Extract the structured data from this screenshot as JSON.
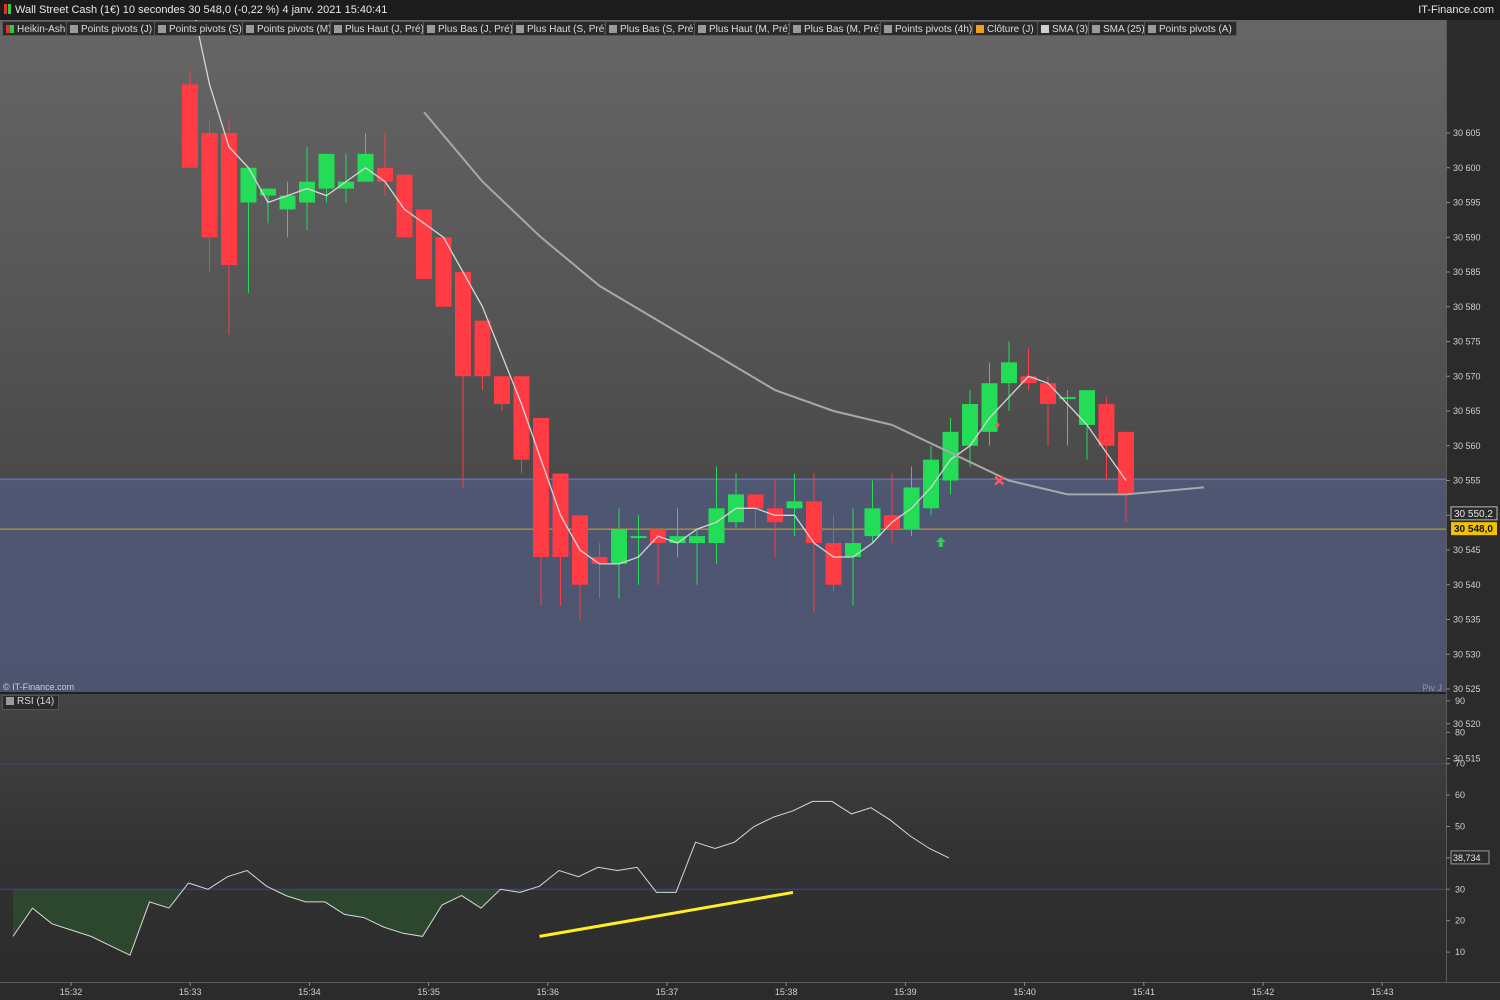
{
  "header": {
    "title": "Wall Street Cash (1€) 10 secondes 30 548,0 (-0,22 %) 4 janv. 2021 15:40:41",
    "brand": "IT-Finance.com"
  },
  "legend": [
    {
      "label": "Heikin-Ashi",
      "swatch": "ha"
    },
    {
      "label": "Points pivots (J)",
      "swatch": "#9a9a9a"
    },
    {
      "label": "Points pivots (S)",
      "swatch": "#9a9a9a"
    },
    {
      "label": "Points pivots (M)",
      "swatch": "#9a9a9a"
    },
    {
      "label": "Plus Haut (J, Pré)",
      "swatch": "#9a9a9a"
    },
    {
      "label": "Plus Bas (J, Pré)",
      "swatch": "#9a9a9a"
    },
    {
      "label": "Plus Haut (S, Pré)",
      "swatch": "#9a9a9a"
    },
    {
      "label": "Plus Bas (S, Pré)",
      "swatch": "#9a9a9a"
    },
    {
      "label": "Plus Haut (M, Pré)",
      "swatch": "#9a9a9a"
    },
    {
      "label": "Plus Bas (M, Pré)",
      "swatch": "#9a9a9a"
    },
    {
      "label": "Points pivots (4h)",
      "swatch": "#9a9a9a"
    },
    {
      "label": "Clôture (J)",
      "swatch": "#f0a020"
    },
    {
      "label": "SMA (3)",
      "swatch": "#cfcfcf"
    },
    {
      "label": "SMA (25)",
      "swatch": "#9a9a9a"
    },
    {
      "label": "Points pivots (A)",
      "swatch": "#9a9a9a"
    }
  ],
  "copyright": "© IT-Finance.com",
  "rsi_label": "RSI (14)",
  "pivot_label": "Piv J",
  "price_badges": {
    "sma": "30 550,2",
    "close": "30 548,0",
    "rsi": "38,734"
  },
  "colors": {
    "bull": "#22dd55",
    "bear": "#ff3b44",
    "pivot_band": "#50597a",
    "pivot_line": "#6b7fe8",
    "close_line": "#e0a020",
    "rsi_trend": "#ffee22",
    "rsi_fill": "#2d4a30",
    "ha_icon_green": "#2ecc40",
    "ha_icon_red": "#e83030"
  },
  "chart_data": [
    {
      "type": "candlestick",
      "title": "Wall Street Cash (1€) 10 secondes",
      "ylim": [
        30510,
        30610
      ],
      "y_ticks": [
        "30 515",
        "30 520",
        "30 525",
        "30 530",
        "30 535",
        "30 540",
        "30 545",
        "30 550",
        "30 555",
        "30 560",
        "30 565",
        "30 570",
        "30 575",
        "30 580",
        "30 585",
        "30 590",
        "30 595",
        "30 600",
        "30 605"
      ],
      "x_ticks": [
        "15:32",
        "15:33",
        "15:34",
        "15:35",
        "15:36",
        "15:37",
        "15:38",
        "15:39",
        "15:40",
        "15:41",
        "15:42",
        "15:43"
      ],
      "levels": {
        "pivot_band_top": 30555.2,
        "pivot_band_bottom": 30524.0,
        "close_j": 30548.0
      },
      "candles": [
        [
          30612,
          30600,
          30614,
          30600
        ],
        [
          30605,
          30590,
          30607,
          30585
        ],
        [
          30605,
          30586,
          30607,
          30576
        ],
        [
          30595,
          30600,
          30599,
          30582
        ],
        [
          30596,
          30597,
          30597,
          30592
        ],
        [
          30594,
          30596,
          30598,
          30590
        ],
        [
          30595,
          30598,
          30603,
          30591
        ],
        [
          30597,
          30602,
          30602,
          30595
        ],
        [
          30597,
          30598,
          30602,
          30595
        ],
        [
          30598,
          30602,
          30605,
          30598
        ],
        [
          30600,
          30598,
          30605,
          30596
        ],
        [
          30599,
          30590,
          30599,
          30590
        ],
        [
          30594,
          30584,
          30594,
          30584
        ],
        [
          30590,
          30580,
          30590,
          30580
        ],
        [
          30585,
          30570,
          30585,
          30554
        ],
        [
          30578,
          30570,
          30578,
          30568
        ],
        [
          30570,
          30566,
          30570,
          30565
        ],
        [
          30570,
          30558,
          30570,
          30556
        ],
        [
          30564,
          30544,
          30564,
          30537
        ],
        [
          30556,
          30544,
          30556,
          30537
        ],
        [
          30550,
          30540,
          30550,
          30535
        ],
        [
          30544,
          30543,
          30546,
          30538
        ],
        [
          30543,
          30548,
          30551,
          30538
        ],
        [
          30547,
          30547,
          30550,
          30540
        ],
        [
          30548,
          30546,
          30548,
          30540
        ],
        [
          30546,
          30547,
          30551,
          30544
        ],
        [
          30546,
          30547,
          30548,
          30540
        ],
        [
          30546,
          30551,
          30557,
          30543
        ],
        [
          30549,
          30553,
          30556,
          30548
        ],
        [
          30553,
          30551,
          30553,
          30548
        ],
        [
          30551,
          30549,
          30555,
          30544
        ],
        [
          30551,
          30552,
          30556,
          30547
        ],
        [
          30552,
          30546,
          30556,
          30536
        ],
        [
          30546,
          30540,
          30550,
          30539
        ],
        [
          30544,
          30546,
          30551,
          30537
        ],
        [
          30547,
          30551,
          30555,
          30546
        ],
        [
          30550,
          30548,
          30556,
          30546
        ],
        [
          30548,
          30554,
          30557,
          30547
        ],
        [
          30551,
          30558,
          30560,
          30550
        ],
        [
          30555,
          30562,
          30564,
          30553
        ],
        [
          30560,
          30566,
          30568,
          30557
        ],
        [
          30562,
          30569,
          30572,
          30560
        ],
        [
          30569,
          30572,
          30575,
          30565
        ],
        [
          30570,
          30569,
          30574,
          30568
        ],
        [
          30569,
          30566,
          30570,
          30560
        ],
        [
          30567,
          30567,
          30568,
          30560
        ],
        [
          30563,
          30568,
          30568,
          30558
        ],
        [
          30566,
          30560,
          30567,
          30555
        ],
        [
          30562,
          30553,
          30562,
          30549
        ]
      ],
      "sma3": [
        30625,
        30612,
        30603,
        30600,
        30595,
        30596,
        30597,
        30596,
        30598,
        30600,
        30598,
        30594,
        30592,
        30590,
        30585,
        30580,
        30573,
        30566,
        30558,
        30550,
        30545,
        30543,
        30543,
        30544,
        30547,
        30546,
        30548,
        30549,
        30551,
        30551,
        30550,
        30550,
        30546,
        30544,
        30544,
        30546,
        30549,
        30551,
        30554,
        30558,
        30560,
        30564,
        30567,
        30570,
        30569,
        30566,
        30563,
        30559,
        30555
      ],
      "sma25": [
        [
          12,
          30608
        ],
        [
          15,
          30598
        ],
        [
          18,
          30590
        ],
        [
          21,
          30583
        ],
        [
          24,
          30578
        ],
        [
          27,
          30573
        ],
        [
          30,
          30568
        ],
        [
          33,
          30565
        ],
        [
          36,
          30563
        ],
        [
          39,
          30559
        ],
        [
          42,
          30555
        ],
        [
          45,
          30553
        ],
        [
          48,
          30553
        ],
        [
          52,
          30554
        ]
      ],
      "markers": [
        {
          "type": "buy-arrow",
          "i": 38.5,
          "price": 30546
        },
        {
          "type": "sell-cross",
          "i": 41.5,
          "price": 30555
        },
        {
          "type": "small-arrow",
          "i": 37.7,
          "price": 30557
        },
        {
          "type": "small-dot",
          "i": 41.4,
          "price": 30563
        }
      ]
    },
    {
      "type": "line",
      "title": "RSI (14)",
      "ylim": [
        0,
        90
      ],
      "y_ticks": [
        10,
        20,
        30,
        40,
        50,
        60,
        70,
        80,
        90
      ],
      "hlines": [
        70,
        30
      ],
      "values": [
        15,
        24,
        19,
        17,
        15,
        12,
        9,
        26,
        24,
        32,
        30,
        34,
        36,
        31,
        28,
        26,
        26,
        22,
        21,
        18,
        16,
        15,
        25,
        28,
        24,
        30,
        29,
        31,
        36,
        34,
        37,
        36,
        37,
        29,
        29,
        45,
        43,
        45,
        50,
        53,
        55,
        58,
        58,
        54,
        56,
        52,
        47,
        43,
        40
      ],
      "trendline": [
        [
          27,
          15
        ],
        [
          40,
          29
        ]
      ]
    }
  ]
}
